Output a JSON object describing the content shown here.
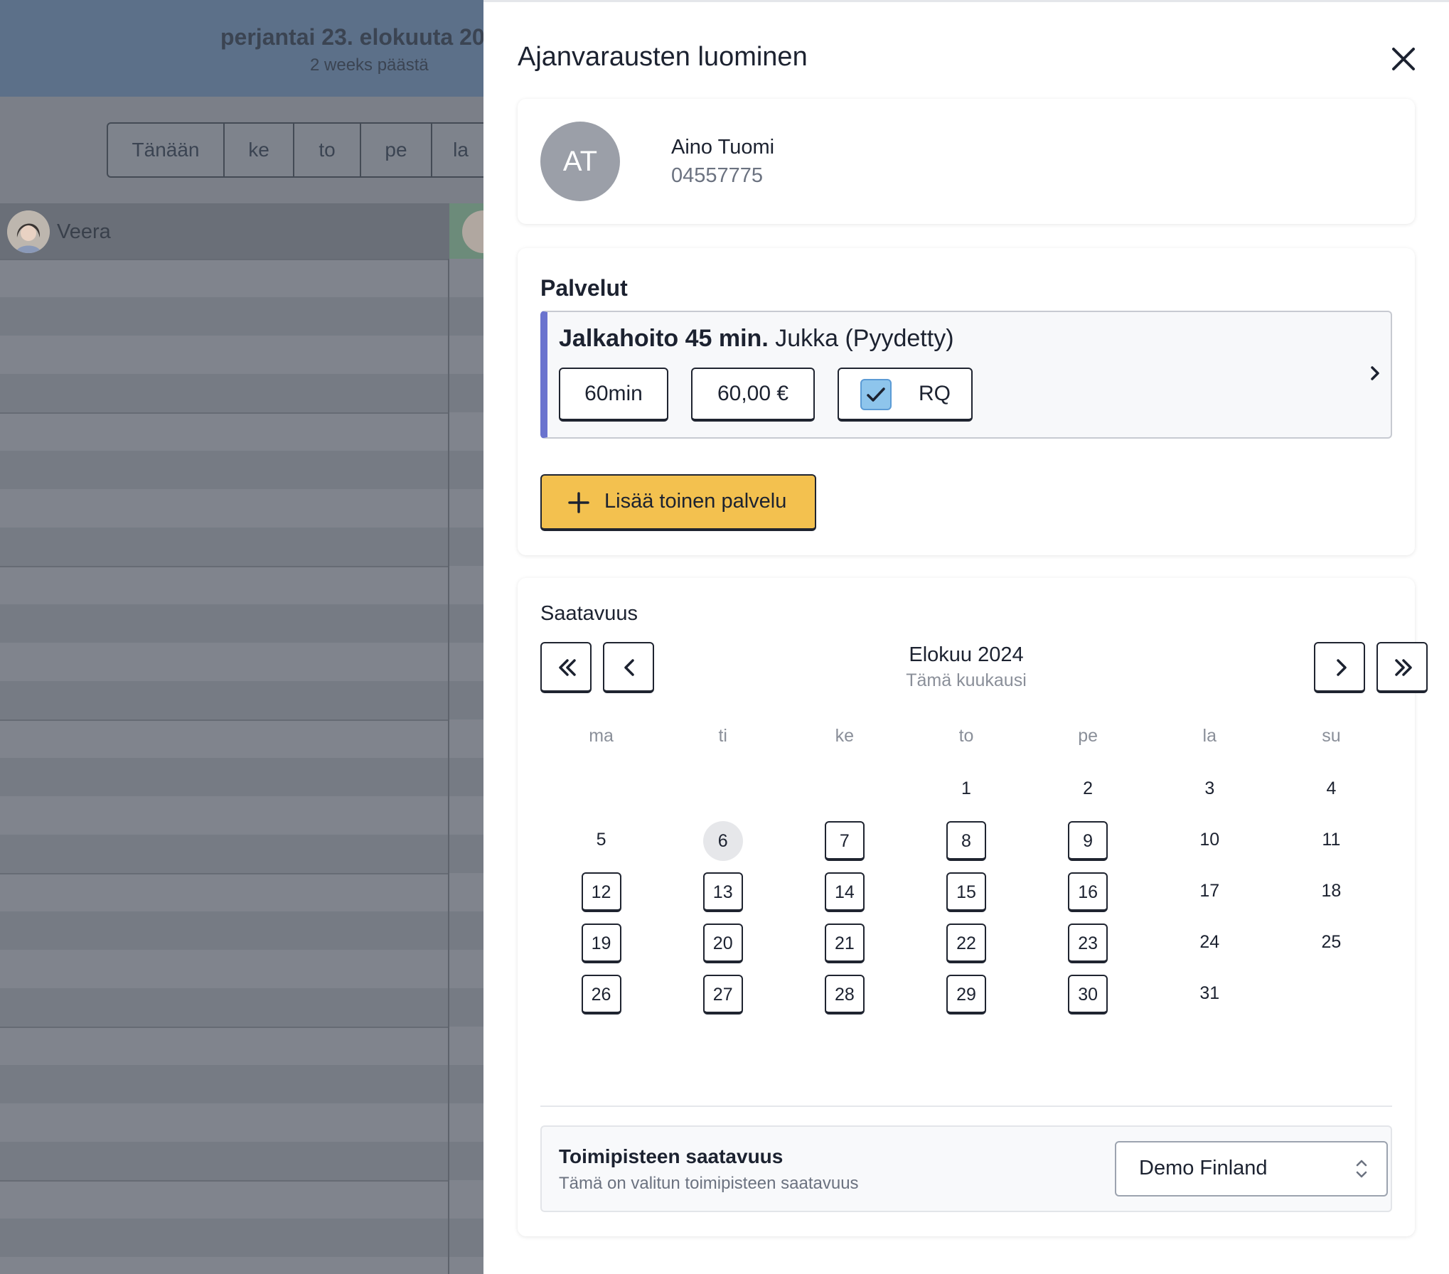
{
  "background": {
    "date_title": "perjantai 23. elokuuta 20",
    "date_subtitle": "2 weeks päästä",
    "day_buttons": [
      "Tänään",
      "ke",
      "to",
      "pe",
      "la"
    ],
    "staff_name": "Veera"
  },
  "panel": {
    "title": "Ajanvarausten luominen",
    "close_icon": "close-icon"
  },
  "customer": {
    "initials": "AT",
    "name": "Aino Tuomi",
    "phone": "04557775"
  },
  "services": {
    "heading": "Palvelut",
    "item": {
      "name": "Jalkahoito 45 min.",
      "staff": "Jukka (Pyydetty)",
      "duration": "60min",
      "price": "60,00 €",
      "rq_label": "RQ",
      "rq_checked": true
    },
    "add_button_label": "Lisää toinen palvelu"
  },
  "availability": {
    "heading": "Saatavuus",
    "month_label": "Elokuu 2024",
    "month_sub": "Tämä kuukausi",
    "weekdays": [
      "ma",
      "ti",
      "ke",
      "to",
      "pe",
      "la",
      "su"
    ],
    "leading_blanks": 3,
    "days": [
      {
        "d": "1",
        "s": "plain"
      },
      {
        "d": "2",
        "s": "plain"
      },
      {
        "d": "3",
        "s": "plain"
      },
      {
        "d": "4",
        "s": "plain"
      },
      {
        "d": "5",
        "s": "plain"
      },
      {
        "d": "6",
        "s": "today"
      },
      {
        "d": "7",
        "s": "avail"
      },
      {
        "d": "8",
        "s": "avail"
      },
      {
        "d": "9",
        "s": "avail"
      },
      {
        "d": "10",
        "s": "plain"
      },
      {
        "d": "11",
        "s": "plain"
      },
      {
        "d": "12",
        "s": "avail"
      },
      {
        "d": "13",
        "s": "avail"
      },
      {
        "d": "14",
        "s": "avail"
      },
      {
        "d": "15",
        "s": "avail"
      },
      {
        "d": "16",
        "s": "avail"
      },
      {
        "d": "17",
        "s": "plain"
      },
      {
        "d": "18",
        "s": "plain"
      },
      {
        "d": "19",
        "s": "avail"
      },
      {
        "d": "20",
        "s": "avail"
      },
      {
        "d": "21",
        "s": "avail"
      },
      {
        "d": "22",
        "s": "avail"
      },
      {
        "d": "23",
        "s": "avail"
      },
      {
        "d": "24",
        "s": "plain"
      },
      {
        "d": "25",
        "s": "plain"
      },
      {
        "d": "26",
        "s": "avail"
      },
      {
        "d": "27",
        "s": "avail"
      },
      {
        "d": "28",
        "s": "avail"
      },
      {
        "d": "29",
        "s": "avail"
      },
      {
        "d": "30",
        "s": "avail"
      },
      {
        "d": "31",
        "s": "plain"
      }
    ],
    "location_title": "Toimipisteen saatavuus",
    "location_subtitle": "Tämä on valitun toimipisteen saatavuus",
    "location_value": "Demo Finland"
  },
  "colors": {
    "accent_service_border": "#6a73ce",
    "add_button": "#f3c14f",
    "checkbox": "#8ec5ec"
  }
}
